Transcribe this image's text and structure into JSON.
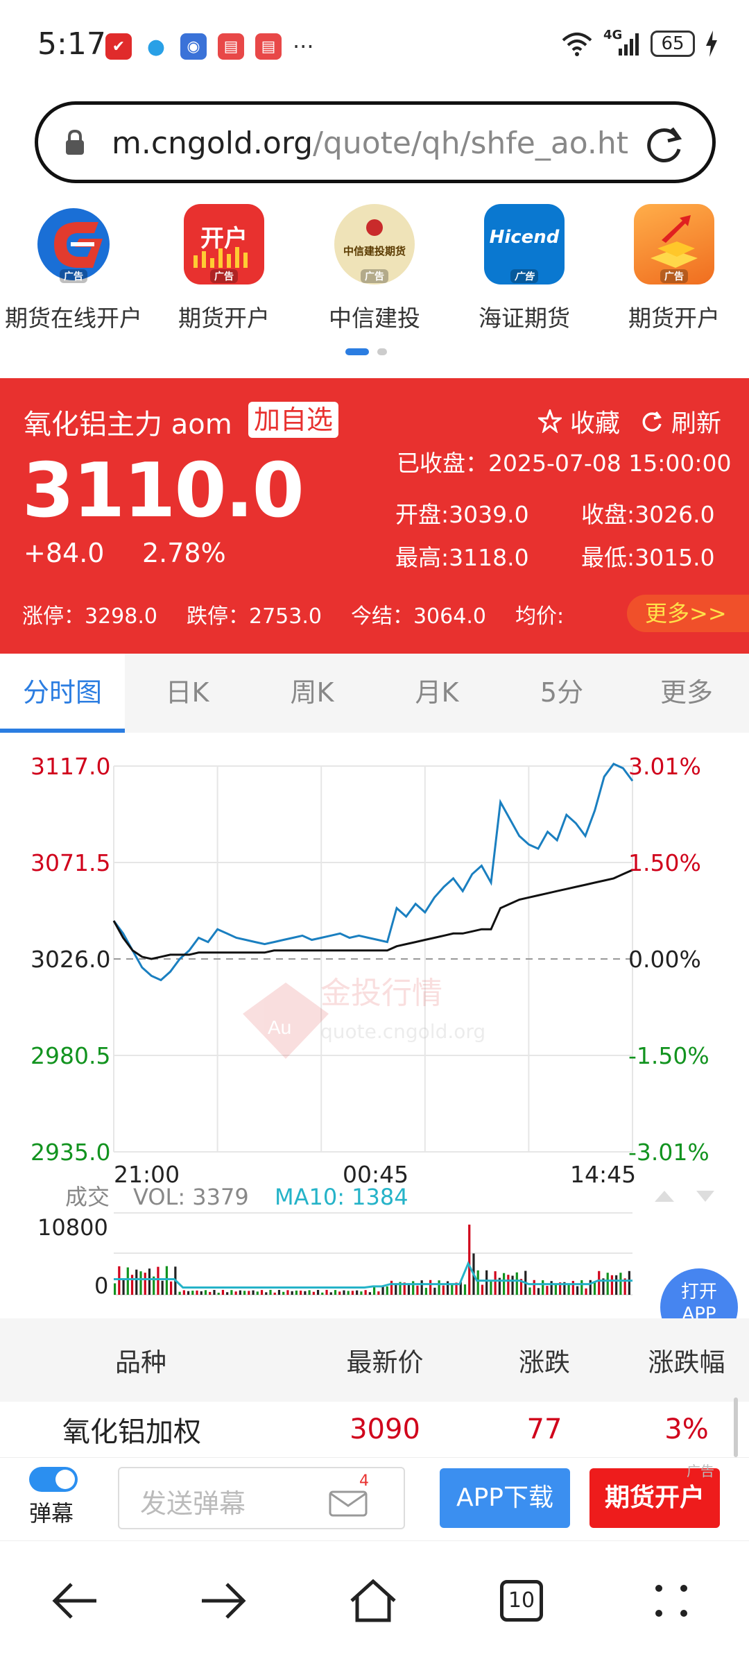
{
  "status": {
    "time": "5:17",
    "battery": "65",
    "network": "4G",
    "dots": "···"
  },
  "url": {
    "host": "m.cngold.org",
    "path": "/quote/qh/shfe_ao.ht"
  },
  "ads": {
    "badge": "广告",
    "items": [
      {
        "label": "期货在线开户",
        "color": "#1a6fd6"
      },
      {
        "label": "期货开户",
        "logo_text": "开户",
        "color": "#e8312f"
      },
      {
        "label": "中信建投",
        "logo_text": "中信建投期货",
        "color": "#e9d9a9"
      },
      {
        "label": "海证期货",
        "logo_text": "Hicend",
        "color": "#0a78d0"
      },
      {
        "label": "期货开户",
        "color": "#f08a22"
      }
    ]
  },
  "quote": {
    "title": "氧化铝主力 aom",
    "add_label": "加自选",
    "fav_label": "收藏",
    "refresh_label": "刷新",
    "price": "3110.0",
    "change": "+84.0",
    "change_pct": "2.78%",
    "status_line": "已收盘：2025-07-08 15:00:00",
    "open": "开盘:3039.0",
    "close": "收盘:3026.0",
    "high": "最高:3118.0",
    "low": "最低:3015.0",
    "limit_up": "涨停：3298.0",
    "limit_down": "跌停：2753.0",
    "settle": "今结：3064.0",
    "avg": "均价:",
    "more": "更多>>"
  },
  "tabs": [
    "分时图",
    "日K",
    "周K",
    "月K",
    "5分",
    "更多"
  ],
  "chart_data": {
    "type": "line",
    "y_left": [
      "3117.0",
      "3071.5",
      "3026.0",
      "2980.5",
      "2935.0"
    ],
    "y_right": [
      "3.01%",
      "1.50%",
      "0.00%",
      "-1.50%",
      "-3.01%"
    ],
    "x_labels": [
      "21:00",
      "00:45",
      "14:45"
    ],
    "ylim": [
      2935.0,
      3117.0
    ],
    "baseline": 3026.0,
    "series": [
      {
        "values": [
          3044,
          3038,
          3030,
          3022,
          3018,
          3016,
          3020,
          3026,
          3030,
          3036,
          3034,
          3040,
          3038,
          3036,
          3035,
          3034,
          3033,
          3034,
          3035,
          3036,
          3037,
          3035,
          3036,
          3037,
          3038,
          3036,
          3037,
          3036,
          3035,
          3034,
          3050,
          3046,
          3052,
          3048,
          3055,
          3060,
          3064,
          3058,
          3066,
          3070,
          3062,
          3100,
          3092,
          3084,
          3080,
          3078,
          3086,
          3082,
          3094,
          3090,
          3084,
          3096,
          3112,
          3118,
          3116,
          3110
        ],
        "color": "#1a7fc0"
      },
      {
        "values": [
          3044,
          3036,
          3030,
          3027,
          3026,
          3027,
          3028,
          3028,
          3028,
          3029,
          3029,
          3029,
          3029,
          3029,
          3029,
          3029,
          3029,
          3030,
          3030,
          3030,
          3030,
          3030,
          3030,
          3030,
          3030,
          3030,
          3030,
          3030,
          3030,
          3030,
          3032,
          3033,
          3034,
          3035,
          3036,
          3037,
          3038,
          3038,
          3039,
          3040,
          3040,
          3050,
          3052,
          3054,
          3055,
          3056,
          3057,
          3058,
          3059,
          3060,
          3061,
          3062,
          3063,
          3064,
          3066,
          3068
        ],
        "color": "#111111"
      }
    ],
    "volume": {
      "label": "成交",
      "vol_text": "VOL: 3379",
      "ma_text": "MA10: 1384",
      "ymax_label": "10800",
      "ymin_label": "0"
    }
  },
  "watermark": {
    "brand": "金投行情",
    "site": "quote.cngold.org",
    "mark": "Au"
  },
  "table": {
    "headers": [
      "品种",
      "最新价",
      "涨跌",
      "涨跌幅"
    ],
    "rows": [
      {
        "name": "氧化铝加权",
        "price": "3090",
        "chg": "77",
        "pct": "3%"
      }
    ]
  },
  "float_app": {
    "line1": "打开",
    "line2": "APP",
    "badge": "广告"
  },
  "bottom": {
    "danmu": "弹幕",
    "send_ph": "发送弹幕",
    "msg_count": "4",
    "app_dl": "APP下载",
    "kaihu": "期货开户",
    "ad": "广告"
  },
  "nav": {
    "tabs_count": "10"
  },
  "colors": {
    "red": "#e8312f",
    "blue": "#2b7de1",
    "up": "#d0021b",
    "down": "#12931f"
  }
}
